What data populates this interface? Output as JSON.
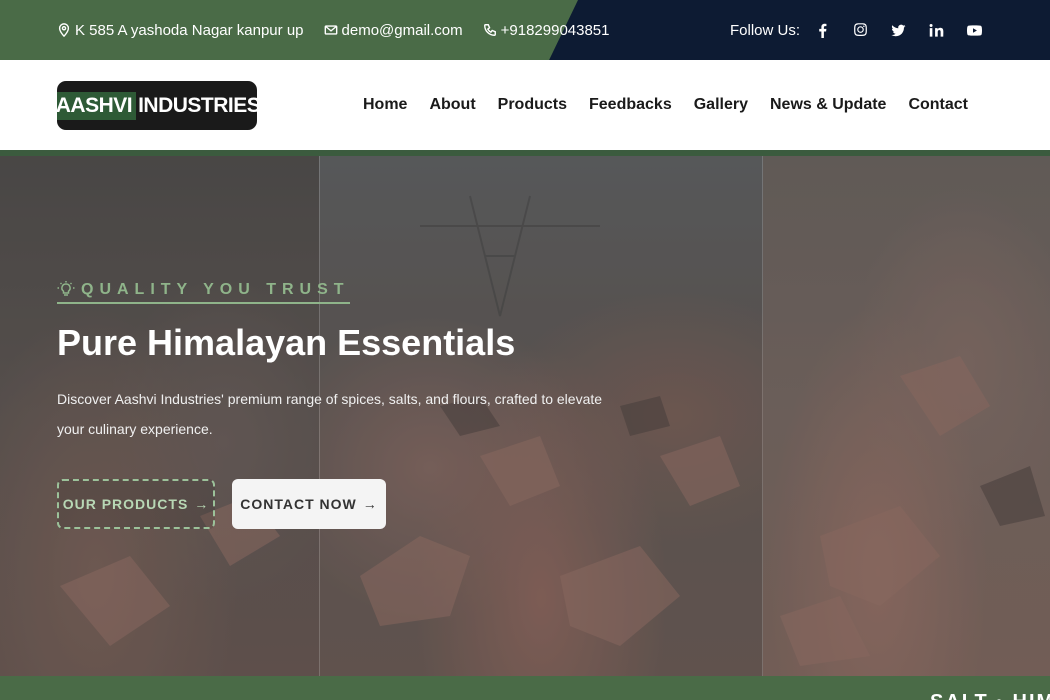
{
  "topbar": {
    "address": "K 585 A yashoda Nagar kanpur up",
    "email": "demo@gmail.com",
    "phone": "+918299043851",
    "follow_label": "Follow Us:",
    "socials": [
      "facebook-icon",
      "instagram-icon",
      "twitter-icon",
      "linkedin-icon",
      "youtube-icon"
    ]
  },
  "brand": {
    "name_part1": "AASHVI",
    "name_part2": "INDUSTRIES"
  },
  "nav": {
    "items": [
      {
        "label": "Home"
      },
      {
        "label": "About"
      },
      {
        "label": "Products"
      },
      {
        "label": "Feedbacks"
      },
      {
        "label": "Gallery"
      },
      {
        "label": "News & Update"
      },
      {
        "label": "Contact"
      }
    ]
  },
  "hero": {
    "tagline": "QUALITY YOU TRUST",
    "title": "Pure Himalayan Essentials",
    "description": "Discover Aashvi Industries' premium range of spices, salts, and flours, crafted to elevate your culinary experience.",
    "btn_products": "OUR PRODUCTS",
    "btn_contact": "CONTACT NOW"
  },
  "marquee": {
    "text": "SALT  ·  HIMA"
  },
  "colors": {
    "dark_navy": "#0d1b33",
    "brand_green": "#4a6b47",
    "accent_green": "#8fb48a"
  }
}
